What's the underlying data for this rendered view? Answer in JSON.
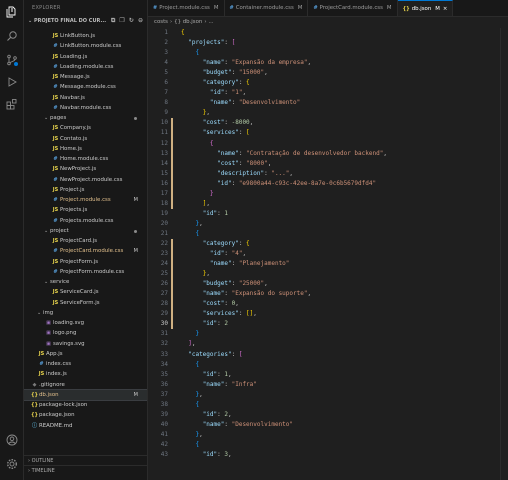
{
  "explorer": {
    "header": "EXPLORER",
    "project_title": "PROJETO FINAL DO CUR...",
    "tools": "⧉ ❐ ↻ ⊖",
    "tree": [
      {
        "label": "LinkButton.js",
        "type": "js",
        "depth": 3
      },
      {
        "label": "LinkButton.module.css",
        "type": "css",
        "depth": 3
      },
      {
        "label": "Loading.js",
        "type": "js",
        "depth": 3
      },
      {
        "label": "Loading.module.css",
        "type": "css",
        "depth": 3
      },
      {
        "label": "Message.js",
        "type": "js",
        "depth": 3
      },
      {
        "label": "Message.module.css",
        "type": "css",
        "depth": 3
      },
      {
        "label": "Navbar.js",
        "type": "js",
        "depth": 3
      },
      {
        "label": "Navbar.module.css",
        "type": "css",
        "depth": 3
      },
      {
        "label": "pages",
        "type": "folder",
        "depth": 2,
        "dot": true
      },
      {
        "label": "Company.js",
        "type": "js",
        "depth": 3
      },
      {
        "label": "Contato.js",
        "type": "js",
        "depth": 3
      },
      {
        "label": "Home.js",
        "type": "js",
        "depth": 3
      },
      {
        "label": "Home.module.css",
        "type": "css",
        "depth": 3
      },
      {
        "label": "NewProject.js",
        "type": "js",
        "depth": 3
      },
      {
        "label": "NewProject.module.css",
        "type": "css",
        "depth": 3
      },
      {
        "label": "Project.js",
        "type": "js",
        "depth": 3
      },
      {
        "label": "Project.module.css",
        "type": "css",
        "depth": 3,
        "badge": "M",
        "modified": true
      },
      {
        "label": "Projects.js",
        "type": "js",
        "depth": 3
      },
      {
        "label": "Projects.module.css",
        "type": "css",
        "depth": 3
      },
      {
        "label": "project",
        "type": "folder",
        "depth": 2,
        "dot": true
      },
      {
        "label": "ProjectCard.js",
        "type": "js",
        "depth": 3
      },
      {
        "label": "ProjectCard.module.css",
        "type": "css",
        "depth": 3,
        "badge": "M",
        "modified": true
      },
      {
        "label": "ProjectForm.js",
        "type": "js",
        "depth": 3
      },
      {
        "label": "ProjectForm.module.css",
        "type": "css",
        "depth": 3
      },
      {
        "label": "service",
        "type": "folder",
        "depth": 2
      },
      {
        "label": "ServiceCard.js",
        "type": "js",
        "depth": 3
      },
      {
        "label": "ServiceForm.js",
        "type": "js",
        "depth": 3
      },
      {
        "label": "img",
        "type": "folder",
        "depth": 1
      },
      {
        "label": "loading.svg",
        "type": "img",
        "depth": 2
      },
      {
        "label": "logo.png",
        "type": "img",
        "depth": 2
      },
      {
        "label": "savings.svg",
        "type": "img",
        "depth": 2
      },
      {
        "label": "App.js",
        "type": "js",
        "depth": 1
      },
      {
        "label": "index.css",
        "type": "css",
        "depth": 1
      },
      {
        "label": "index.js",
        "type": "js",
        "depth": 1
      },
      {
        "label": ".gitignore",
        "type": "git",
        "depth": 0
      },
      {
        "label": "db.json",
        "type": "json",
        "depth": 0,
        "badge": "M",
        "selected": true,
        "modified": true
      },
      {
        "label": "package-lock.json",
        "type": "json",
        "depth": 0
      },
      {
        "label": "package.json",
        "type": "json",
        "depth": 0
      },
      {
        "label": "README.md",
        "type": "md",
        "depth": 0
      }
    ],
    "outline": "OUTLINE",
    "timeline": "TIMELINE"
  },
  "tabs": [
    {
      "label": "Project.module.css",
      "icon": "#",
      "type": "css",
      "status": "M"
    },
    {
      "label": "Container.module.css",
      "icon": "#",
      "type": "css",
      "status": "M"
    },
    {
      "label": "ProjectCard.module.css",
      "icon": "#",
      "type": "css",
      "status": "M"
    },
    {
      "label": "db.json",
      "icon": "{}",
      "type": "json",
      "status": "M",
      "active": true
    }
  ],
  "breadcrumb": [
    "costs",
    "{} db.json",
    "..."
  ],
  "code_lines": [
    [
      [
        "b1",
        "{"
      ]
    ],
    [
      [
        "p",
        "  "
      ],
      [
        "k",
        "\"projects\""
      ],
      [
        "p",
        ": "
      ],
      [
        "b2",
        "["
      ]
    ],
    [
      [
        "p",
        "    "
      ],
      [
        "b3",
        "{"
      ]
    ],
    [
      [
        "p",
        "      "
      ],
      [
        "k",
        "\"name\""
      ],
      [
        "p",
        ": "
      ],
      [
        "s",
        "\"Expansão da empresa\""
      ],
      [
        "p",
        ","
      ]
    ],
    [
      [
        "p",
        "      "
      ],
      [
        "k",
        "\"budget\""
      ],
      [
        "p",
        ": "
      ],
      [
        "s",
        "\"15000\""
      ],
      [
        "p",
        ","
      ]
    ],
    [
      [
        "p",
        "      "
      ],
      [
        "k",
        "\"category\""
      ],
      [
        "p",
        ": "
      ],
      [
        "b1",
        "{"
      ]
    ],
    [
      [
        "p",
        "        "
      ],
      [
        "k",
        "\"id\""
      ],
      [
        "p",
        ": "
      ],
      [
        "s",
        "\"1\""
      ],
      [
        "p",
        ","
      ]
    ],
    [
      [
        "p",
        "        "
      ],
      [
        "k",
        "\"name\""
      ],
      [
        "p",
        ": "
      ],
      [
        "s",
        "\"Desenvolvimento\""
      ]
    ],
    [
      [
        "p",
        "      "
      ],
      [
        "b1",
        "}"
      ],
      [
        "p",
        ","
      ]
    ],
    [
      [
        "p",
        "      "
      ],
      [
        "k",
        "\"cost\""
      ],
      [
        "p",
        ": "
      ],
      [
        "n",
        "-8000"
      ],
      [
        "p",
        ","
      ]
    ],
    [
      [
        "p",
        "      "
      ],
      [
        "k",
        "\"services\""
      ],
      [
        "p",
        ": "
      ],
      [
        "b1",
        "["
      ]
    ],
    [
      [
        "p",
        "        "
      ],
      [
        "b2",
        "{"
      ]
    ],
    [
      [
        "p",
        "          "
      ],
      [
        "k",
        "\"name\""
      ],
      [
        "p",
        ": "
      ],
      [
        "s",
        "\"Contratação de desenvolvedor backend\""
      ],
      [
        "p",
        ","
      ]
    ],
    [
      [
        "p",
        "          "
      ],
      [
        "k",
        "\"cost\""
      ],
      [
        "p",
        ": "
      ],
      [
        "s",
        "\"8000\""
      ],
      [
        "p",
        ","
      ]
    ],
    [
      [
        "p",
        "          "
      ],
      [
        "k",
        "\"description\""
      ],
      [
        "p",
        ": "
      ],
      [
        "s",
        "\"...\""
      ],
      [
        "p",
        ","
      ]
    ],
    [
      [
        "p",
        "          "
      ],
      [
        "k",
        "\"id\""
      ],
      [
        "p",
        ": "
      ],
      [
        "s",
        "\"e9800a44-c93c-42ee-8a7e-0c6b5679dfd4\""
      ]
    ],
    [
      [
        "p",
        "        "
      ],
      [
        "b2",
        "}"
      ]
    ],
    [
      [
        "p",
        "      "
      ],
      [
        "b1",
        "]"
      ],
      [
        "p",
        ","
      ]
    ],
    [
      [
        "p",
        "      "
      ],
      [
        "k",
        "\"id\""
      ],
      [
        "p",
        ": "
      ],
      [
        "n",
        "1"
      ]
    ],
    [
      [
        "p",
        "    "
      ],
      [
        "b3",
        "}"
      ],
      [
        "p",
        ","
      ]
    ],
    [
      [
        "p",
        "    "
      ],
      [
        "b3",
        "{"
      ]
    ],
    [
      [
        "p",
        "      "
      ],
      [
        "k",
        "\"category\""
      ],
      [
        "p",
        ": "
      ],
      [
        "b1",
        "{"
      ]
    ],
    [
      [
        "p",
        "        "
      ],
      [
        "k",
        "\"id\""
      ],
      [
        "p",
        ": "
      ],
      [
        "s",
        "\"4\""
      ],
      [
        "p",
        ","
      ]
    ],
    [
      [
        "p",
        "        "
      ],
      [
        "k",
        "\"name\""
      ],
      [
        "p",
        ": "
      ],
      [
        "s",
        "\"Planejamento\""
      ]
    ],
    [
      [
        "p",
        "      "
      ],
      [
        "b1",
        "}"
      ],
      [
        "p",
        ","
      ]
    ],
    [
      [
        "p",
        "      "
      ],
      [
        "k",
        "\"budget\""
      ],
      [
        "p",
        ": "
      ],
      [
        "s",
        "\"25000\""
      ],
      [
        "p",
        ","
      ]
    ],
    [
      [
        "p",
        "      "
      ],
      [
        "k",
        "\"name\""
      ],
      [
        "p",
        ": "
      ],
      [
        "s",
        "\"Expansão do suporte\""
      ],
      [
        "p",
        ","
      ]
    ],
    [
      [
        "p",
        "      "
      ],
      [
        "k",
        "\"cost\""
      ],
      [
        "p",
        ": "
      ],
      [
        "n",
        "0"
      ],
      [
        "p",
        ","
      ]
    ],
    [
      [
        "p",
        "      "
      ],
      [
        "k",
        "\"services\""
      ],
      [
        "p",
        ": "
      ],
      [
        "b1",
        "[]"
      ],
      [
        "p",
        ","
      ]
    ],
    [
      [
        "p",
        "      "
      ],
      [
        "k",
        "\"id\""
      ],
      [
        "p",
        ": "
      ],
      [
        "n",
        "2"
      ]
    ],
    [
      [
        "p",
        "    "
      ],
      [
        "b3",
        "}"
      ]
    ],
    [
      [
        "p",
        "  "
      ],
      [
        "b2",
        "]"
      ],
      [
        "p",
        ","
      ]
    ],
    [
      [
        "p",
        "  "
      ],
      [
        "k",
        "\"categories\""
      ],
      [
        "p",
        ": "
      ],
      [
        "b2",
        "["
      ]
    ],
    [
      [
        "p",
        "    "
      ],
      [
        "b3",
        "{"
      ]
    ],
    [
      [
        "p",
        "      "
      ],
      [
        "k",
        "\"id\""
      ],
      [
        "p",
        ": "
      ],
      [
        "n",
        "1"
      ],
      [
        "p",
        ","
      ]
    ],
    [
      [
        "p",
        "      "
      ],
      [
        "k",
        "\"name\""
      ],
      [
        "p",
        ": "
      ],
      [
        "s",
        "\"Infra\""
      ]
    ],
    [
      [
        "p",
        "    "
      ],
      [
        "b3",
        "}"
      ],
      [
        "p",
        ","
      ]
    ],
    [
      [
        "p",
        "    "
      ],
      [
        "b3",
        "{"
      ]
    ],
    [
      [
        "p",
        "      "
      ],
      [
        "k",
        "\"id\""
      ],
      [
        "p",
        ": "
      ],
      [
        "n",
        "2"
      ],
      [
        "p",
        ","
      ]
    ],
    [
      [
        "p",
        "      "
      ],
      [
        "k",
        "\"name\""
      ],
      [
        "p",
        ": "
      ],
      [
        "s",
        "\"Desenvolvimento\""
      ]
    ],
    [
      [
        "p",
        "    "
      ],
      [
        "b3",
        "}"
      ],
      [
        "p",
        ","
      ]
    ],
    [
      [
        "p",
        "    "
      ],
      [
        "b3",
        "{"
      ]
    ],
    [
      [
        "p",
        "      "
      ],
      [
        "k",
        "\"id\""
      ],
      [
        "p",
        ": "
      ],
      [
        "n",
        "3"
      ],
      [
        "p",
        ","
      ]
    ]
  ],
  "modified_lines": [
    10,
    11,
    12,
    13,
    14,
    15,
    16,
    17,
    18,
    22,
    23,
    24,
    25,
    26,
    27,
    28,
    29,
    30
  ],
  "current_line": 30,
  "icons": [
    "files-icon",
    "search-icon",
    "source-control-icon",
    "run-debug-icon",
    "extensions-icon",
    "account-icon",
    "settings-icon"
  ],
  "colors": {
    "accent": "#0078d4",
    "modified": "#e2c08d",
    "badge": "#0078d4"
  }
}
